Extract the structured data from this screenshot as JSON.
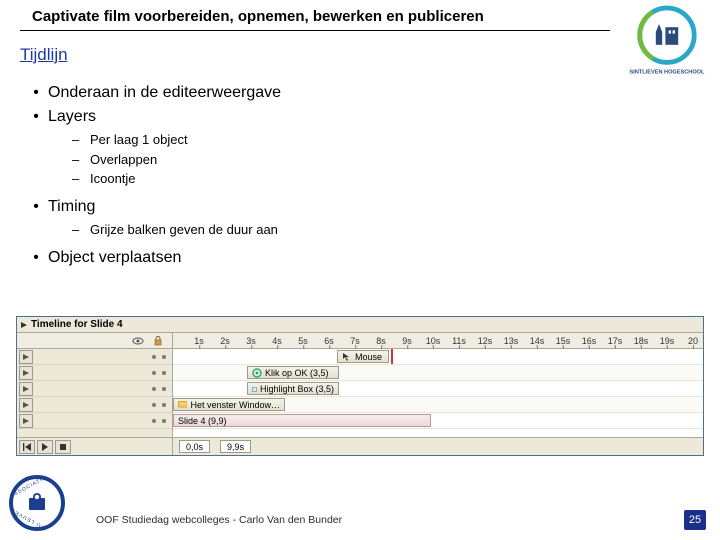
{
  "header": {
    "title": "Captivate film voorbereiden, opnemen, bewerken en publiceren"
  },
  "section": {
    "title": "Tijdlijn"
  },
  "bullets": {
    "b1": "Onderaan in de editeerweergave",
    "b2": "Layers",
    "b2_sub": {
      "s1": "Per laag 1 object",
      "s2": "Overlappen",
      "s3": "Icoontje"
    },
    "b3": "Timing",
    "b3_sub": {
      "s1": "Grijze balken geven de duur aan"
    },
    "b4": "Object verplaatsen"
  },
  "timeline": {
    "title": "Timeline for Slide 4",
    "ruler_marks": [
      "1s",
      "2s",
      "3s",
      "4s",
      "5s",
      "6s",
      "7s",
      "8s",
      "9s",
      "10s",
      "11s",
      "12s",
      "13s",
      "14s",
      "15s",
      "16s",
      "17s",
      "18s",
      "19s",
      "20"
    ],
    "bars": {
      "mouse": "Mouse",
      "click": "Klik op OK (3,5)",
      "highlight": "Highlight Box (3,5)",
      "vindow": "Het venster Window…",
      "slide": "Slide 4 (9,9)"
    },
    "footer": {
      "t1": "0,0s",
      "t2": "9,9s"
    }
  },
  "footer": {
    "text": "OOF Studiedag webcolleges - Carlo Van den Bunder",
    "page": "25"
  }
}
